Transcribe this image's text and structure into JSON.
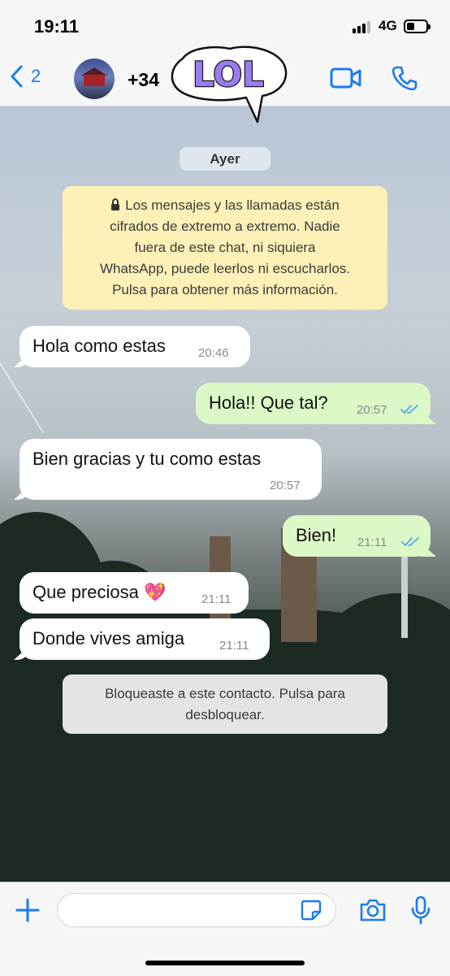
{
  "status_bar": {
    "time": "19:11",
    "network": "4G"
  },
  "header": {
    "back_count": "2",
    "contact_name": "+34",
    "sticker_text": "LOL",
    "icons": [
      "chevron-left-icon",
      "video-call-icon",
      "phone-icon"
    ]
  },
  "chat": {
    "date_label": "Ayer",
    "encryption_notice": {
      "lines": [
        "Los mensajes y las llamadas están",
        "cifrados de extremo a extremo. Nadie",
        "fuera de este chat, ni siquiera",
        "WhatsApp, puede leerlos ni escucharlos.",
        "Pulsa para obtener más información."
      ]
    },
    "messages": [
      {
        "direction": "in",
        "text": "Hola como estas",
        "time": "20:46"
      },
      {
        "direction": "out",
        "text": "Hola!! Que tal?",
        "time": "20:57",
        "read": true
      },
      {
        "direction": "in",
        "text": "Bien gracias y tu como estas",
        "time": "20:57"
      },
      {
        "direction": "out",
        "text": "Bien!",
        "time": "21:11",
        "read": true
      },
      {
        "direction": "in",
        "text": "Que preciosa 💖",
        "time": "21:11"
      },
      {
        "direction": "in",
        "text": "Donde vives amiga",
        "time": "21:11"
      }
    ],
    "blocked_notice": {
      "lines": [
        "Bloqueaste a este contacto. Pulsa para",
        "desbloquear."
      ]
    }
  },
  "input_bar": {
    "placeholder": "",
    "icons": [
      "plus-icon",
      "sticker-icon",
      "camera-icon",
      "microphone-icon"
    ]
  },
  "colors": {
    "accent": "#1a7cf0",
    "outgoing_bubble": "#dcf8c6",
    "incoming_bubble": "#ffffff",
    "encryption_bg": "#fdf1b7",
    "read_ticks": "#4fa8e8"
  }
}
